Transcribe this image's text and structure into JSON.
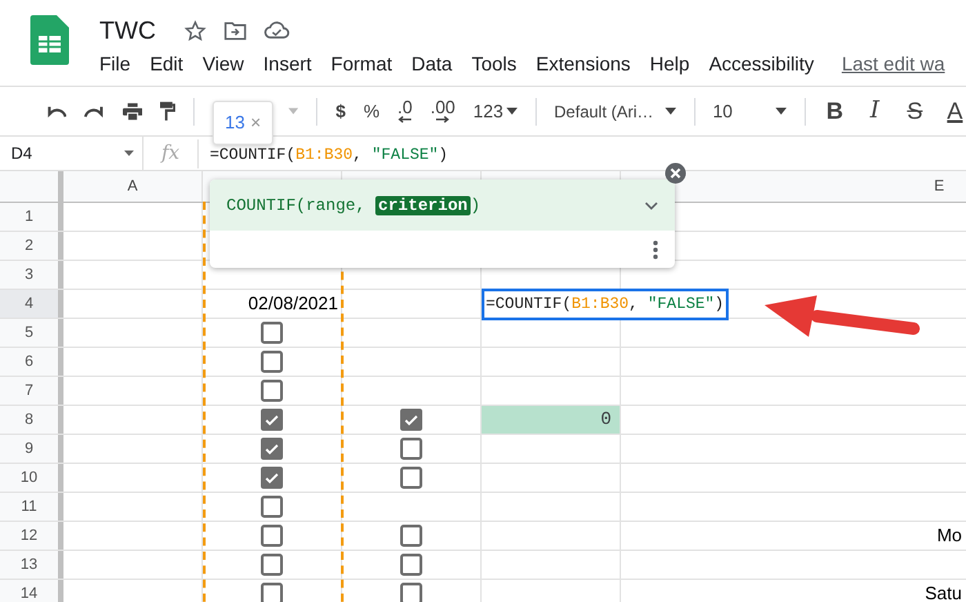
{
  "document": {
    "title": "TWC",
    "last_edit": "Last edit wa"
  },
  "menu": [
    "File",
    "Edit",
    "View",
    "Insert",
    "Format",
    "Data",
    "Tools",
    "Extensions",
    "Help",
    "Accessibility"
  ],
  "toolbar": {
    "tooltip": {
      "text": "13",
      "close": "×"
    },
    "number_formats": [
      "$",
      "%",
      ".0",
      ".00",
      "123"
    ],
    "font": "Default (Ari…",
    "font_size": "10",
    "text_styles": [
      {
        "text": "B",
        "kind": "bold"
      },
      {
        "text": "I",
        "kind": "italic"
      },
      {
        "text": "S",
        "kind": "strike"
      },
      {
        "text": "A",
        "kind": "color"
      }
    ]
  },
  "formula_bar": {
    "name_box": "D4",
    "fx": "fx",
    "formula": [
      {
        "text": "=COUNTIF(",
        "kind": "plain"
      },
      {
        "text": "B1:B30",
        "kind": "range"
      },
      {
        "text": ", ",
        "kind": "plain"
      },
      {
        "text": "\"FALSE\"",
        "kind": "string"
      },
      {
        "text": ")",
        "kind": "plain"
      }
    ]
  },
  "column_a_header": "A",
  "column_e_header": "E",
  "rows": [
    {
      "number": "1",
      "selected": false
    },
    {
      "number": "2",
      "selected": false
    },
    {
      "number": "3",
      "selected": false
    },
    {
      "number": "4",
      "selected": true,
      "b": {
        "kind": "date",
        "text": "02/08/2021"
      },
      "d": {
        "kind": "editor",
        "formula": [
          {
            "text": "=COUNTIF(",
            "kind": "plain"
          },
          {
            "text": "B1:B30",
            "kind": "range"
          },
          {
            "text": ", ",
            "kind": "plain"
          },
          {
            "text": "\"FALSE\"",
            "kind": "string"
          },
          {
            "text": ")",
            "kind": "plain"
          }
        ]
      }
    },
    {
      "number": "5",
      "selected": false,
      "b": {
        "kind": "checkbox",
        "checked": false
      }
    },
    {
      "number": "6",
      "selected": false,
      "b": {
        "kind": "checkbox",
        "checked": false
      }
    },
    {
      "number": "7",
      "selected": false,
      "b": {
        "kind": "checkbox",
        "checked": false
      }
    },
    {
      "number": "8",
      "selected": false,
      "b": {
        "kind": "checkbox",
        "checked": true
      },
      "c": {
        "kind": "checkbox",
        "checked": true
      },
      "d": {
        "kind": "result",
        "text": "0"
      }
    },
    {
      "number": "9",
      "selected": false,
      "b": {
        "kind": "checkbox",
        "checked": true
      },
      "c": {
        "kind": "checkbox",
        "checked": false
      }
    },
    {
      "number": "10",
      "selected": false,
      "b": {
        "kind": "checkbox",
        "checked": true
      },
      "c": {
        "kind": "checkbox",
        "checked": false
      }
    },
    {
      "number": "11",
      "selected": false,
      "b": {
        "kind": "checkbox",
        "checked": false
      }
    },
    {
      "number": "12",
      "selected": false,
      "b": {
        "kind": "checkbox",
        "checked": false
      },
      "c": {
        "kind": "checkbox",
        "checked": false
      },
      "e": {
        "kind": "text",
        "text": "Mo"
      }
    },
    {
      "number": "13",
      "selected": false,
      "b": {
        "kind": "checkbox",
        "checked": false
      },
      "c": {
        "kind": "checkbox",
        "checked": false
      }
    },
    {
      "number": "14",
      "selected": false,
      "b": {
        "kind": "checkbox",
        "checked": false
      },
      "c": {
        "kind": "checkbox",
        "checked": false
      },
      "e": {
        "kind": "text",
        "text": "Satu"
      }
    }
  ],
  "function_help": [
    {
      "text": "COUNTIF(range, ",
      "kind": "plain"
    },
    {
      "text": "criterion",
      "kind": "active"
    },
    {
      "text": ")",
      "kind": "plain"
    }
  ]
}
